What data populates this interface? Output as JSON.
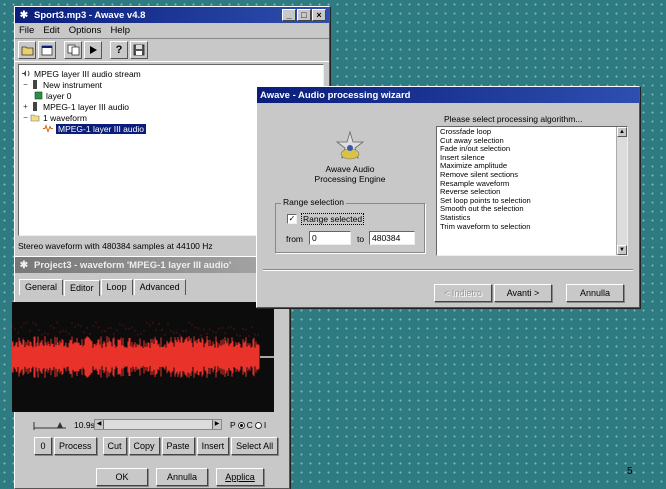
{
  "main_window": {
    "title": "Sport3.mp3 - Awave v4.8",
    "menu": [
      "File",
      "Edit",
      "Options",
      "Help"
    ],
    "toolbar_icons": [
      "open-folder-icon",
      "window-icon",
      "copy-icon",
      "play-icon",
      "help-icon",
      "save-icon"
    ],
    "tree": [
      {
        "label": "MPEG layer III audio stream",
        "level": 0,
        "toggle": "",
        "icon": "stream-icon"
      },
      {
        "label": "New instrument",
        "level": 1,
        "toggle": "−",
        "icon": "instrument-icon"
      },
      {
        "label": "layer 0",
        "level": 2,
        "toggle": "",
        "icon": "layer-icon"
      },
      {
        "label": "MPEG-1 layer III audio",
        "level": 1,
        "toggle": "+",
        "icon": "audio-icon"
      },
      {
        "label": "1 waveform",
        "level": 1,
        "toggle": "−",
        "icon": "folder-icon"
      },
      {
        "label": "MPEG-1 layer III audio",
        "level": 2,
        "toggle": "",
        "icon": "waveform-icon",
        "selected": true
      }
    ],
    "status": "Stereo waveform with 480384 samples at 44100 Hz"
  },
  "waveform_window": {
    "title": "Project3 - waveform 'MPEG-1 layer III audio'",
    "tabs": [
      "General",
      "Editor",
      "Loop",
      "Advanced"
    ],
    "active_tab": "Editor",
    "zoom_value": "10.9s",
    "channel_options": [
      "P",
      "C",
      "I"
    ],
    "buttons": [
      "0",
      "Process",
      "Cut",
      "Copy",
      "Paste",
      "Insert",
      "Select All"
    ],
    "dialog_buttons": [
      "OK",
      "Annulla",
      "Applica"
    ],
    "wave_color": "#e8322a"
  },
  "wizard": {
    "title": "Awave - Audio processing wizard",
    "engine_label": "Awave Audio\nProcessing Engine",
    "range_group": "Range selection",
    "range_checkbox": "Range selected",
    "range_checked": true,
    "from_label": "from",
    "from_value": "0",
    "to_label": "to",
    "to_value": "480384",
    "list_header": "Please select processing algorithm...",
    "algorithms": [
      "Crossfade loop",
      "Cut away selection",
      "Fade in/out selection",
      "Insert silence",
      "Maximize amplitude",
      "Remove silent sections",
      "Resample waveform",
      "Reverse selection",
      "Set loop points to selection",
      "Smooth out the selection",
      "Statistics",
      "Trim waveform to selection"
    ],
    "buttons": {
      "back": "< Indietro",
      "next": "Avanti >",
      "cancel": "Annulla"
    }
  },
  "page_number": "5",
  "colors": {
    "desktop": "#2e7b82",
    "title_active": "#0a1d7a",
    "window": "#c8c8c8"
  }
}
